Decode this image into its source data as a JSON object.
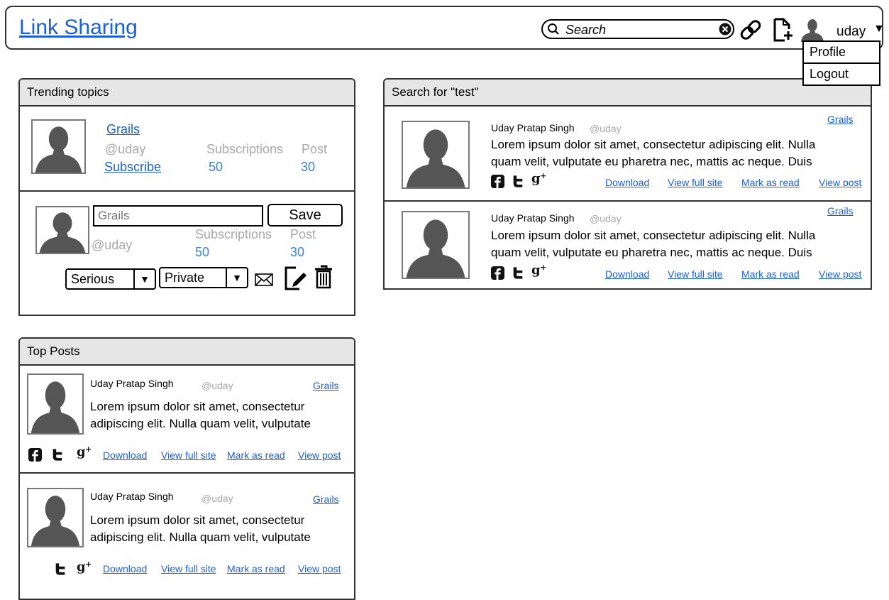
{
  "header": {
    "brand": "Link Sharing",
    "search_placeholder": "Search",
    "username": "uday",
    "menu": [
      "Profile",
      "Logout"
    ]
  },
  "trending": {
    "title": "Trending topics",
    "topic1": {
      "name": "Grails",
      "handle": "@uday",
      "action": "Subscribe",
      "subs_label": "Subscriptions",
      "subs_value": "50",
      "post_label": "Post",
      "post_value": "30"
    },
    "topic2": {
      "name_placeholder": "Grails",
      "save": "Save",
      "handle": "@uday",
      "subs_label": "Subscriptions",
      "subs_value": "50",
      "post_label": "Post",
      "post_value": "30",
      "seriousness": "Serious",
      "visibility": "Private"
    }
  },
  "search_results": {
    "title": "Search for \"test\"",
    "items": [
      {
        "author": "Uday Pratap Singh",
        "handle": "@uday",
        "topic": "Grails",
        "text1": "Lorem ipsum dolor sit amet, consectetur adipiscing elit. Nulla",
        "text2": "quam velit, vulputate eu pharetra nec, mattis ac neque. Duis"
      },
      {
        "author": "Uday Pratap Singh",
        "handle": "@uday",
        "topic": "Grails",
        "text1": "Lorem ipsum dolor sit amet, consectetur adipiscing elit. Nulla",
        "text2": "quam velit, vulputate eu pharetra nec, mattis ac neque. Duis"
      }
    ]
  },
  "top_posts": {
    "title": "Top Posts",
    "items": [
      {
        "author": "Uday Pratap Singh",
        "handle": "@uday",
        "topic": "Grails",
        "text1": "Lorem ipsum dolor sit amet, consectetur",
        "text2": "adipiscing elit. Nulla quam velit, vulputate"
      },
      {
        "author": "Uday Pratap Singh",
        "handle": "@uday",
        "topic": "Grails",
        "text1": "Lorem ipsum dolor sit amet, consectetur",
        "text2": "adipiscing elit. Nulla quam velit, vulputate"
      }
    ]
  },
  "actions": {
    "download": "Download",
    "view_full_site": "View full site",
    "mark_as_read": "Mark as read",
    "view_post": "View post"
  },
  "colors": {
    "link": "#1a5fd6",
    "numbers": "#3a82d8",
    "muted": "#a8a8a8",
    "header_bg": "#e6e6e6",
    "avatar": "#555555"
  },
  "icons": [
    "search-icon",
    "clear-icon",
    "link-icon",
    "add-document-icon",
    "user-icon",
    "caret-down-icon",
    "facebook-icon",
    "twitter-icon",
    "google-plus-icon",
    "mail-icon",
    "edit-icon",
    "trash-icon"
  ]
}
